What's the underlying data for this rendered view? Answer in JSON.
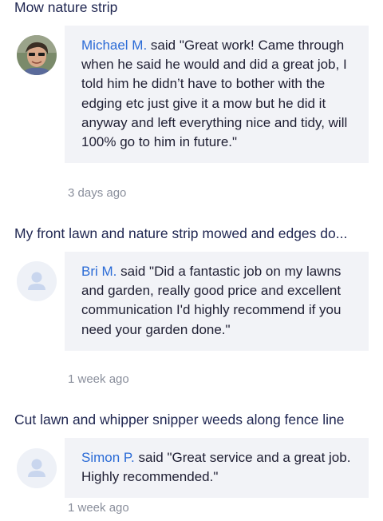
{
  "reviews": [
    {
      "title": "Mow nature strip",
      "reviewer": "Michael M.",
      "said": "said",
      "quote": "\"Great work! Came through when he said he would and did a great job, I told him he didn’t have to bother with the edging etc just give it a mow but he did it anyway and left everything nice and tidy, will 100% go to him in future.\"",
      "time": "3 days ago",
      "avatar": "photo-avatar"
    },
    {
      "title": "My front lawn and nature strip mowed and edges do...",
      "reviewer": "Bri M.",
      "said": "said",
      "quote": "\"Did a fantastic job on my lawns and garden, really good price and excellent communication I'd highly recommend if you need your garden done.\"",
      "time": "1 week ago",
      "avatar": "default-user-icon"
    },
    {
      "title": "Cut lawn and whipper snipper weeds along fence line",
      "reviewer": "Simon P.",
      "said": "said",
      "quote": "\"Great service and a great job. Highly recommended.\"",
      "time": "1 week ago",
      "avatar": "default-user-icon"
    }
  ],
  "colors": {
    "name_link": "#2b6bd6",
    "bubble_bg": "#f2f3f7",
    "title_text": "#1e2550",
    "timestamp": "#8a8f9c"
  }
}
